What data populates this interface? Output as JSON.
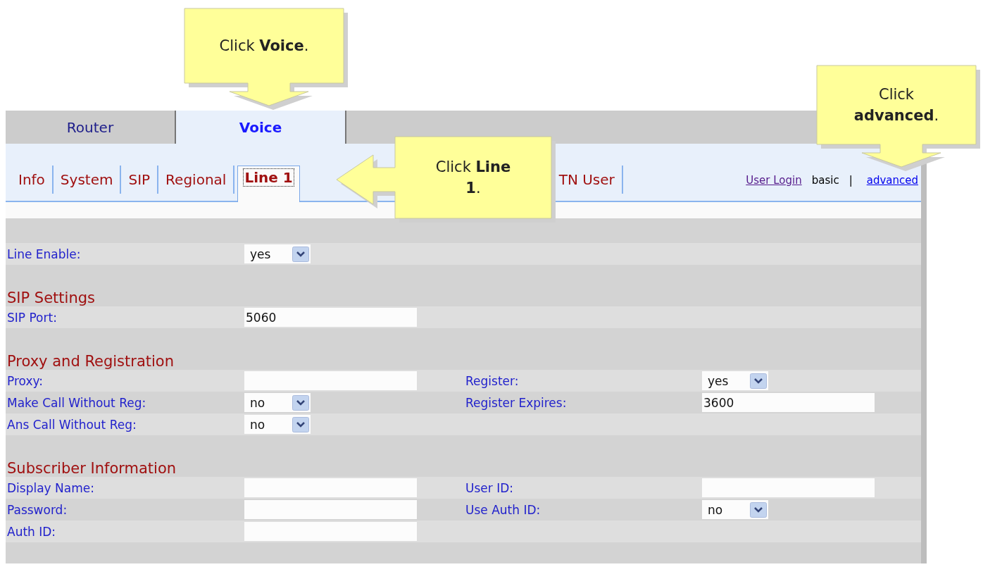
{
  "top_tabs": [
    {
      "label": "Router",
      "selected": false
    },
    {
      "label": "Voice",
      "selected": true
    }
  ],
  "sub_tabs": [
    {
      "label": "Info",
      "selected": false
    },
    {
      "label": "System",
      "selected": false
    },
    {
      "label": "SIP",
      "selected": false
    },
    {
      "label": "Regional",
      "selected": false
    },
    {
      "label": "Line 1",
      "selected": true
    },
    {
      "label": "TN User",
      "selected": false
    }
  ],
  "header_links": {
    "login": "User Login",
    "separator": "|",
    "modes": [
      {
        "label": "basic",
        "selected": true
      },
      {
        "label": "advanced",
        "selected": false
      }
    ]
  },
  "sections": [
    {
      "rows": [
        {
          "fields": [
            {
              "label": "Line Enable:",
              "kind": "select",
              "value": "yes"
            }
          ]
        }
      ]
    },
    {
      "heading": "SIP Settings",
      "rows": [
        {
          "fields": [
            {
              "label": "SIP Port:",
              "kind": "text",
              "value": "5060"
            }
          ]
        }
      ]
    },
    {
      "heading": "Proxy and Registration",
      "rows": [
        {
          "fields": [
            {
              "label": "Proxy:",
              "kind": "text"
            },
            {
              "label": "Register:",
              "kind": "select",
              "value": "yes"
            }
          ]
        },
        {
          "fields": [
            {
              "label": "Make Call Without Reg:",
              "kind": "select",
              "value": "no"
            },
            {
              "label": "Register Expires:",
              "kind": "text",
              "value": "3600"
            }
          ]
        },
        {
          "fields": [
            {
              "label": "Ans Call Without Reg:",
              "kind": "select",
              "value": "no"
            }
          ]
        }
      ]
    },
    {
      "heading": "Subscriber Information",
      "rows": [
        {
          "fields": [
            {
              "label": "Display Name:",
              "kind": "text"
            },
            {
              "label": "User ID:",
              "kind": "text"
            }
          ]
        },
        {
          "fields": [
            {
              "label": "Password:",
              "kind": "text"
            },
            {
              "label": "Use Auth ID:",
              "kind": "select",
              "value": "no"
            }
          ]
        },
        {
          "fields": [
            {
              "label": "Auth ID:",
              "kind": "text"
            }
          ]
        }
      ]
    }
  ],
  "callouts": [
    {
      "text": "Click **Voice**.",
      "kind": "down"
    },
    {
      "text": "Click **Line 1**.",
      "kind": "left"
    },
    {
      "text": "Click **advanced**.",
      "kind": "down"
    }
  ]
}
